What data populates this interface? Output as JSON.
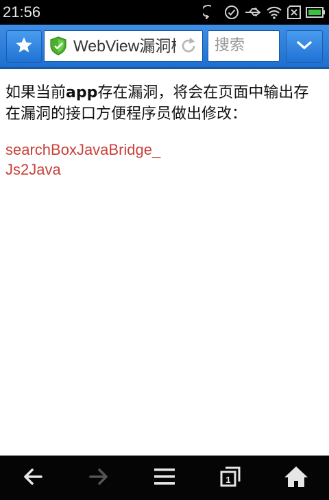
{
  "status_bar": {
    "time": "21:56",
    "icons": [
      "chat-bubble-icon",
      "check-circle-icon",
      "usb-icon",
      "wifi-icon",
      "sim-x-icon",
      "battery-icon"
    ]
  },
  "toolbar": {
    "favorite_icon": "star-icon",
    "security_icon": "shield-check-icon",
    "page_title": "WebView漏洞检测",
    "refresh_icon": "refresh-icon",
    "search_placeholder": "搜索",
    "menu_icon": "chevron-down-icon",
    "accent_color": "#2a7fde"
  },
  "content": {
    "intro_before": "如果当前",
    "intro_bold": "app",
    "intro_after": "存在漏洞，将会在页面中输出存在漏洞的接口方便程序员做出修改：",
    "result_line1": "searchBoxJavaBridge_",
    "result_line2": "Js2Java",
    "result_color": "#c8413a"
  },
  "bottom_bar": {
    "items": [
      {
        "name": "back-arrow-icon",
        "enabled": true
      },
      {
        "name": "forward-arrow-icon",
        "enabled": false
      },
      {
        "name": "menu-lines-icon",
        "enabled": true
      },
      {
        "name": "tabs-icon",
        "enabled": true,
        "badge": "1"
      },
      {
        "name": "home-icon",
        "enabled": true
      }
    ]
  }
}
